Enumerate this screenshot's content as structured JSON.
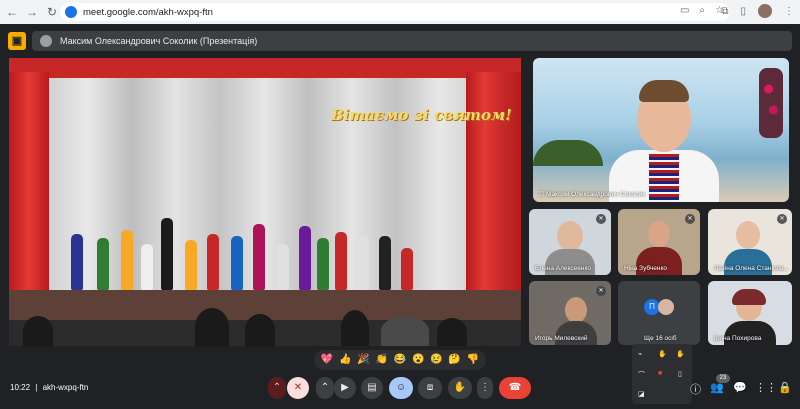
{
  "browser": {
    "url": "meet.google.com/akh-wxpq-ftn"
  },
  "presenter_bar": {
    "text": "Максим Олександрович Соколик (Презентація)"
  },
  "presentation": {
    "banner": "Вітаємо зі святом!"
  },
  "host": {
    "name": "Максим Олександрович Соколик"
  },
  "participants": [
    {
      "name": "Елена Алексеенко",
      "muted": true
    },
    {
      "name": "Ніна Зубченко",
      "muted": true
    },
    {
      "name": "Лазіна Олена Станісла...",
      "muted": true
    },
    {
      "name": "Игорь Милевский",
      "muted": true
    },
    {
      "name": "Ще 16 осіб",
      "muted": true,
      "avatar_letter": "П"
    },
    {
      "name": "Ірина Похирова",
      "muted": false
    }
  ],
  "reactions": [
    "💖",
    "👍",
    "🎉",
    "👏",
    "😂",
    "😮",
    "😢",
    "🤔",
    "👎"
  ],
  "bottom_bar": {
    "time": "10:22",
    "separator": "|",
    "meeting_code": "akh-wxpq-ftn",
    "people_count": "23"
  }
}
